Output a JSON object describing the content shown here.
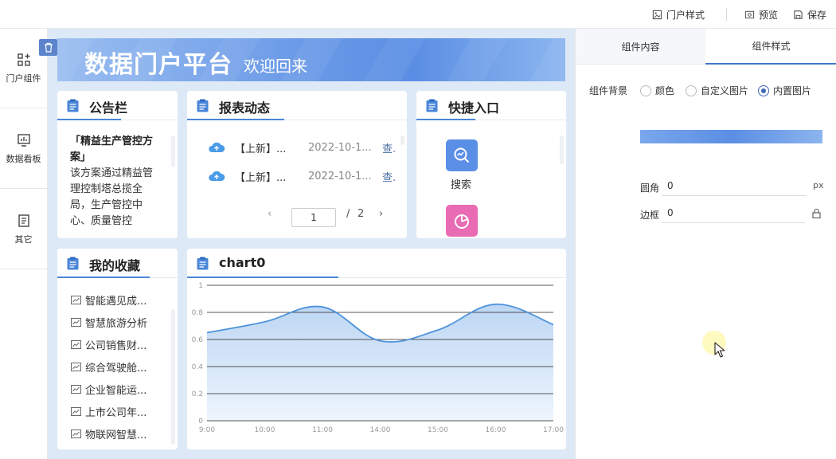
{
  "topbar": {
    "portal_style": "门户样式",
    "preview": "预览",
    "save": "保存"
  },
  "sidebar": {
    "items": [
      {
        "label": "门户组件",
        "icon": "grid-add-icon"
      },
      {
        "label": "数据看板",
        "icon": "dashboard-icon"
      },
      {
        "label": "其它",
        "icon": "document-icon"
      }
    ]
  },
  "banner": {
    "title": "数据门户平台",
    "subtitle": "欢迎回来"
  },
  "notice": {
    "title": "公告栏",
    "headline": "「精益生产管控方案」",
    "body": "该方案通过精益管理控制塔总揽全局，生产管控中心、质量管控"
  },
  "reports": {
    "title": "报表动态",
    "rows": [
      {
        "name": "【上新】...",
        "date": "2022-10-1...",
        "action": "查."
      },
      {
        "name": "【上新】...",
        "date": "2022-10-1...",
        "action": "查."
      }
    ],
    "pager": {
      "prev": "‹",
      "current": "1",
      "separator": "/",
      "total": "2",
      "next": "›"
    }
  },
  "shortcuts": {
    "title": "快捷入口",
    "items": [
      {
        "label": "搜索",
        "icon": "search-chart-icon",
        "color": "#5b8fe6"
      },
      {
        "label": "",
        "icon": "pie-chart-icon",
        "color": "#e86bb3"
      }
    ]
  },
  "favorites": {
    "title": "我的收藏",
    "items": [
      "智能遇见成...",
      "智慧旅游分析",
      "公司销售财...",
      "综合驾驶舱...",
      "企业智能运...",
      "上市公司年...",
      "物联网智慧..."
    ]
  },
  "chart_data": {
    "type": "area",
    "title": "chart0",
    "categories": [
      "9:00",
      "10:00",
      "11:00",
      "14:00",
      "15:00",
      "16:00",
      "17:00"
    ],
    "x": [
      "9:00",
      "10:00",
      "11:00",
      "14:00",
      "15:00",
      "16:00",
      "17:00"
    ],
    "series": [
      {
        "values": [
          0.65,
          0.73,
          0.84,
          0.59,
          0.67,
          0.86,
          0.71
        ]
      }
    ],
    "ylim": [
      0,
      1
    ],
    "yticks": [
      "0",
      "0.2",
      "0.4",
      "0.6",
      "0.8",
      "1"
    ],
    "grid": true,
    "colors": {
      "line": "#4e93da",
      "fill_top": "#bdd6f4",
      "fill_bottom": "#eef5fd"
    }
  },
  "panel": {
    "tabs": [
      {
        "label": "组件内容",
        "active": false
      },
      {
        "label": "组件样式",
        "active": true
      }
    ],
    "background_label": "组件背景",
    "background_options": [
      {
        "label": "颜色",
        "checked": false
      },
      {
        "label": "自定义图片",
        "checked": false
      },
      {
        "label": "内置图片",
        "checked": true
      }
    ],
    "radius_label": "圆角",
    "radius_value": "0",
    "radius_unit": "px",
    "border_label": "边框",
    "border_value": "0"
  },
  "colors": {
    "accent": "#3c78c8",
    "canvas_bg": "#dde9f7",
    "card_title_icon": "#4a86d8"
  }
}
